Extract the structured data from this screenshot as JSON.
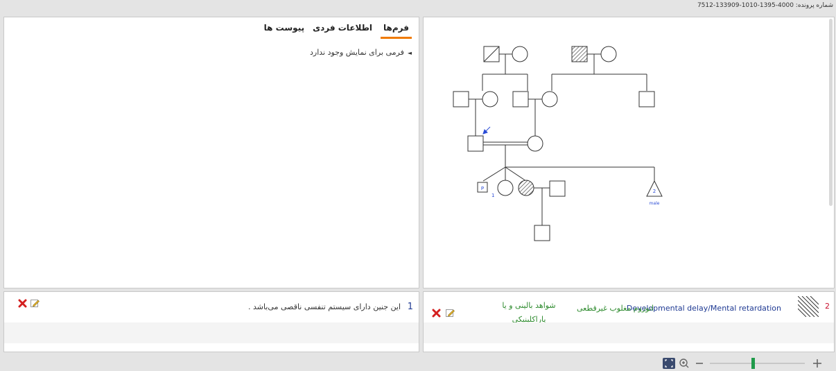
{
  "header": {
    "file_number": "شماره پرونده: 4000-1395-1010-133909-7512"
  },
  "tabs": [
    {
      "label": "فرم‌ها"
    },
    {
      "label": "اطلاعات فردی"
    },
    {
      "label": "پیوست ها"
    }
  ],
  "forms": {
    "empty_message": "فرمی برای نمایش وجود ندارد"
  },
  "pedigree": {
    "proband_label": "P",
    "proband_number": "1",
    "pregnancy_count": "2",
    "pregnancy_sex": "male"
  },
  "disease": {
    "number": "2",
    "name": "Developmental delay/Mental retardation",
    "inheritance": "اتوزوم مغلوب   غیرقطعی",
    "evidence": "شواهد بالینی و یا پاراکلینیکی"
  },
  "note": {
    "number": "1",
    "text": "این جنین دارای سیستم تنفسی ناقصی می‌باشد ."
  },
  "colors": {
    "accent": "#f07a00",
    "link": "#1f3a93",
    "green": "#2e8b2e",
    "red": "#c8102e",
    "slider": "#1f9a4a"
  }
}
